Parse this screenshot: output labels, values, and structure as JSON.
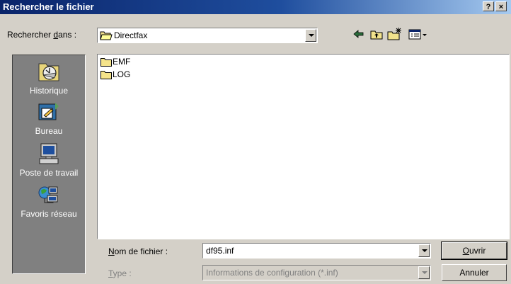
{
  "dialog": {
    "title": "Rechercher le fichier",
    "help_label": "?",
    "close_label": "×"
  },
  "look_in": {
    "label_pre": "Rechercher ",
    "label_hotkey": "d",
    "label_post": "ans :",
    "value": "Directfax"
  },
  "places": [
    {
      "label": "Historique",
      "icon": "history-icon"
    },
    {
      "label": "Bureau",
      "icon": "desktop-icon"
    },
    {
      "label": "Poste de travail",
      "icon": "my-computer-icon"
    },
    {
      "label": "Favoris réseau",
      "icon": "network-places-icon"
    }
  ],
  "files": [
    {
      "name": "EMF",
      "icon": "folder-icon"
    },
    {
      "name": "LOG",
      "icon": "folder-icon"
    }
  ],
  "file_name": {
    "label_hotkey": "N",
    "label_rest": "om de fichier :",
    "value": "df95.inf"
  },
  "file_type": {
    "label_hotkey": "T",
    "label_rest": "ype :",
    "value": "Informations de configuration (*.inf)"
  },
  "buttons": {
    "open_hotkey": "O",
    "open_rest": "uvrir",
    "cancel": "Annuler"
  }
}
